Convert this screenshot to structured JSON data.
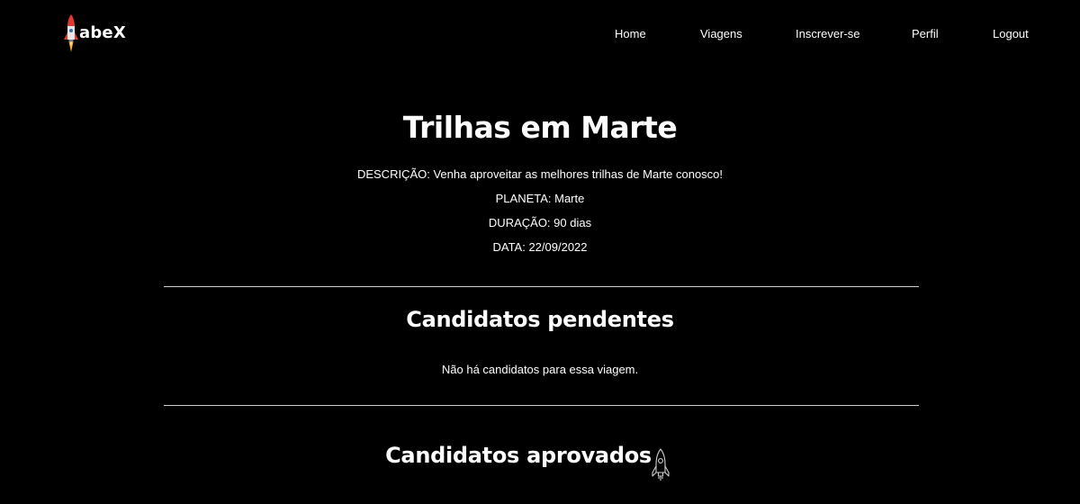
{
  "nav": {
    "brand": "abeX",
    "links": [
      {
        "label": "Home"
      },
      {
        "label": "Viagens"
      },
      {
        "label": "Inscrever-se"
      },
      {
        "label": "Perfil"
      },
      {
        "label": "Logout"
      }
    ]
  },
  "trip": {
    "title": "Trilhas em Marte",
    "description": "DESCRIÇÃO: Venha aproveitar as melhores trilhas de Marte conosco!",
    "planet": "PLANETA: Marte",
    "duration": "DURAÇÃO: 90 dias",
    "date": "DATA: 22/09/2022"
  },
  "pending": {
    "title": "Candidatos pendentes",
    "empty_message": "Não há candidatos para essa viagem."
  },
  "approved": {
    "title": "Candidatos aprovados"
  },
  "icons": {
    "logo": "rocket-icon",
    "approved_section": "rocket-outline-icon"
  },
  "colors": {
    "background": "#000000",
    "text": "#ffffff",
    "divider": "#cfcfcf",
    "logo_rocket_accent": "#e03a2f"
  }
}
